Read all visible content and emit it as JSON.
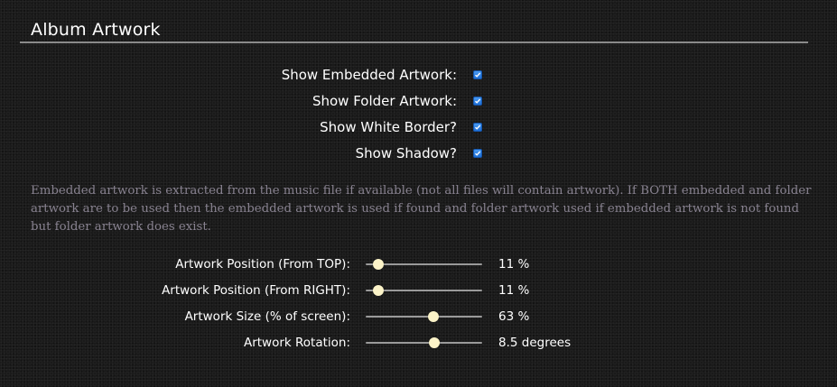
{
  "section": {
    "title": "Album Artwork"
  },
  "options": [
    {
      "label": "Show Embedded Artwork:",
      "checked": true
    },
    {
      "label": "Show Folder Artwork:",
      "checked": true
    },
    {
      "label": "Show White Border?",
      "checked": true
    },
    {
      "label": "Show Shadow?",
      "checked": true
    }
  ],
  "description": "Embedded artwork is extracted from the music file if available (not all files will contain artwork). If BOTH embedded and folder artwork are to be used then the embedded artwork is used if found and folder artwork used if embedded artwork is not found but folder artwork does exist.",
  "sliders": [
    {
      "label": "Artwork Position (From TOP):",
      "value": "11 %",
      "level": 0.11
    },
    {
      "label": "Artwork Position (From RIGHT):",
      "value": "11 %",
      "level": 0.11
    },
    {
      "label": "Artwork Size (% of screen):",
      "value": "63 %",
      "level": 0.58
    },
    {
      "label": "Artwork Rotation:",
      "value": "8.5 degrees",
      "level": 0.59
    }
  ],
  "colors": {
    "background": "#1a1a1a",
    "description_text": "#888290",
    "checkbox": "#2a7de3",
    "slider_thumb": "#fbf3c8"
  }
}
